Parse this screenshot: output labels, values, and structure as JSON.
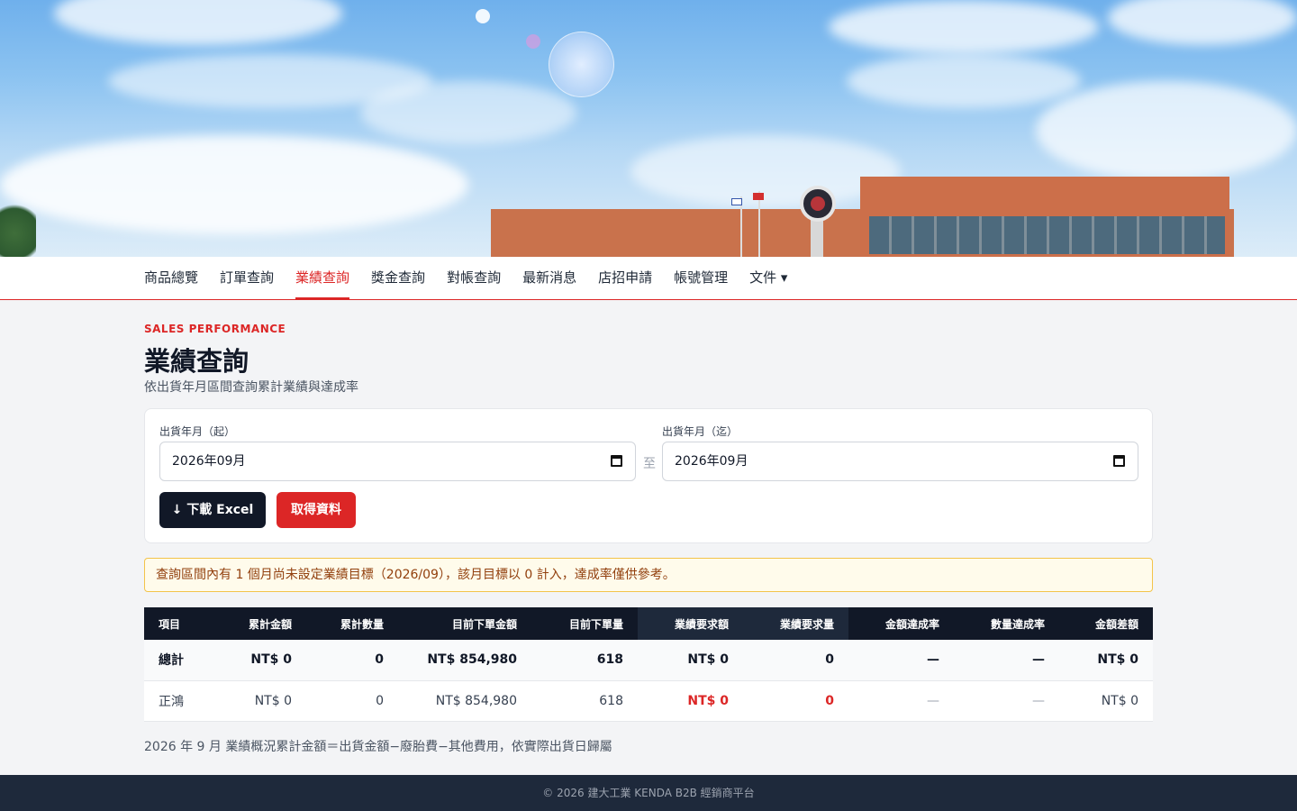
{
  "nav": {
    "items": [
      {
        "label": "商品總覽"
      },
      {
        "label": "訂單查詢"
      },
      {
        "label": "業績查詢"
      },
      {
        "label": "獎金查詢"
      },
      {
        "label": "對帳查詢"
      },
      {
        "label": "最新消息"
      },
      {
        "label": "店招申請"
      },
      {
        "label": "帳號管理"
      },
      {
        "label": "文件 ▾"
      }
    ],
    "active_index": 2
  },
  "header": {
    "eyebrow": "SALES PERFORMANCE",
    "title": "業績查詢",
    "subtitle": "依出貨年月區間查詢累計業績與達成率"
  },
  "filter": {
    "start_label": "出貨年月（起）",
    "start_value": "2026年09月",
    "to_label": "至",
    "end_label": "出貨年月（迄）",
    "end_value": "2026年09月",
    "download_label": "↓  下載 Excel",
    "fetch_label": "取得資料"
  },
  "alert": {
    "text": "查詢區間內有 1 個月尚未設定業績目標（2026/09），該月目標以 0 計入，達成率僅供參考。"
  },
  "table": {
    "headers": [
      "項目",
      "累計金額",
      "累計數量",
      "目前下單金額",
      "目前下單量",
      "業績要求額",
      "業績要求量",
      "金額達成率",
      "數量達成率",
      "金額差額"
    ],
    "rows": [
      [
        "總計",
        "NT$ 0",
        "0",
        "NT$ 854,980",
        "618",
        "NT$ 0",
        "0",
        "—",
        "—",
        "NT$ 0"
      ],
      [
        "正鴻",
        "NT$ 0",
        "0",
        "NT$ 854,980",
        "618",
        "NT$ 0",
        "0",
        "—",
        "—",
        "NT$ 0"
      ]
    ]
  },
  "footnote": "2026 年 9 月 業績概況累計金額＝出貨金額−廢胎費−其他費用，依實際出貨日歸屬",
  "footer": "© 2026 建大工業 KENDA B2B 經銷商平台",
  "colors": {
    "accent": "#dc2626",
    "dark": "#111827",
    "alert_bg": "#fffbeb",
    "footer_bg": "#1e293b"
  }
}
